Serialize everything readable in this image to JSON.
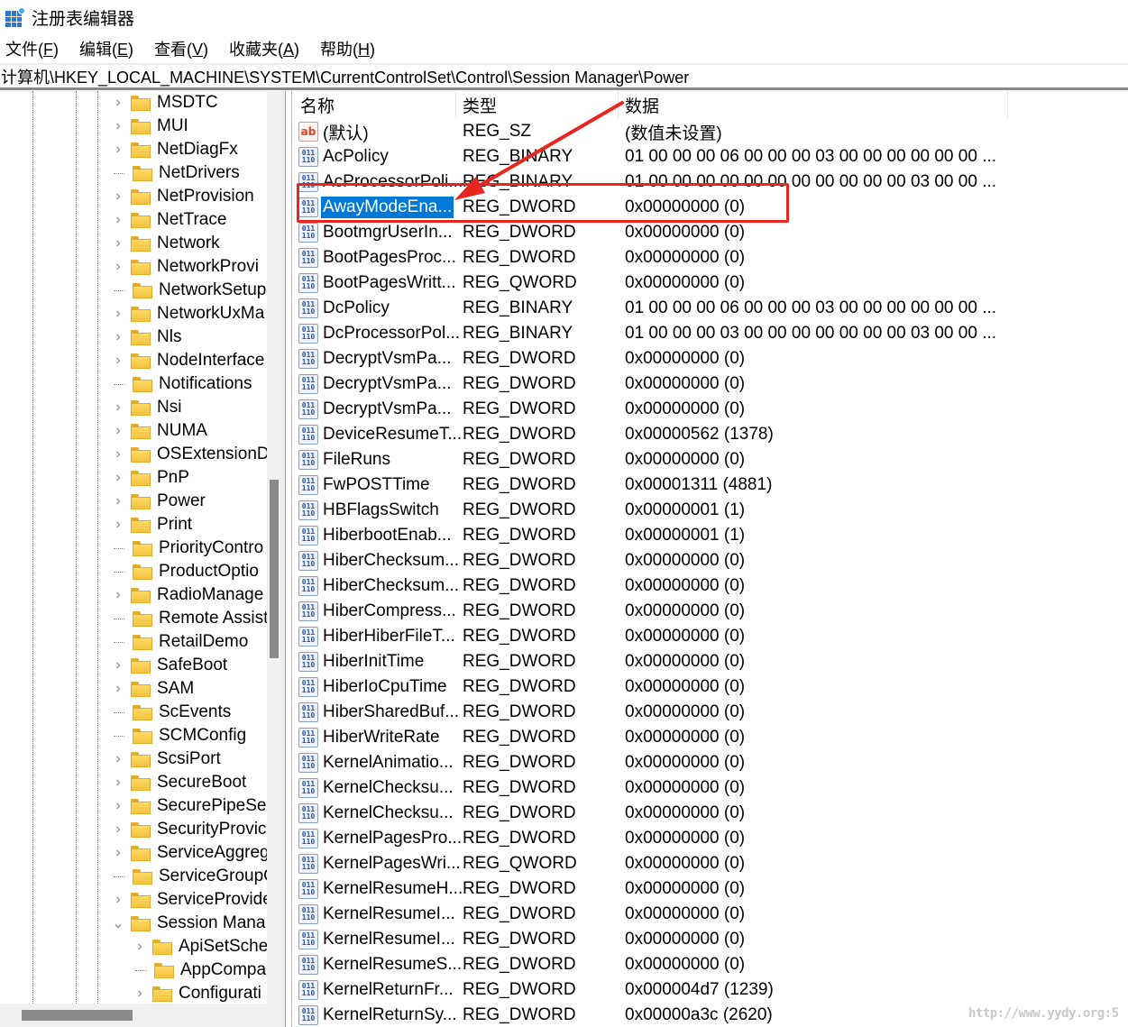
{
  "window": {
    "title": "注册表编辑器",
    "icon": "registry-editor-icon"
  },
  "menu": [
    {
      "label": "文件(",
      "key": "F",
      "suffix": ")"
    },
    {
      "label": "编辑(",
      "key": "E",
      "suffix": ")"
    },
    {
      "label": "查看(",
      "key": "V",
      "suffix": ")"
    },
    {
      "label": "收藏夹(",
      "key": "A",
      "suffix": ")"
    },
    {
      "label": "帮助(",
      "key": "H",
      "suffix": ")"
    }
  ],
  "address": "计算机\\HKEY_LOCAL_MACHINE\\SYSTEM\\CurrentControlSet\\Control\\Session Manager\\Power",
  "tree": {
    "items": [
      {
        "label": "MSDTC",
        "expandable": true,
        "level": 0
      },
      {
        "label": "MUI",
        "expandable": true,
        "level": 0
      },
      {
        "label": "NetDiagFx",
        "expandable": true,
        "level": 0
      },
      {
        "label": "NetDrivers",
        "expandable": false,
        "level": 0
      },
      {
        "label": "NetProvision",
        "expandable": true,
        "level": 0
      },
      {
        "label": "NetTrace",
        "expandable": true,
        "level": 0
      },
      {
        "label": "Network",
        "expandable": true,
        "level": 0
      },
      {
        "label": "NetworkProvi",
        "expandable": true,
        "level": 0
      },
      {
        "label": "NetworkSetup",
        "expandable": false,
        "level": 0
      },
      {
        "label": "NetworkUxMa",
        "expandable": true,
        "level": 0
      },
      {
        "label": "Nls",
        "expandable": true,
        "level": 0
      },
      {
        "label": "NodeInterface",
        "expandable": true,
        "level": 0
      },
      {
        "label": "Notifications",
        "expandable": false,
        "level": 0
      },
      {
        "label": "Nsi",
        "expandable": true,
        "level": 0
      },
      {
        "label": "NUMA",
        "expandable": true,
        "level": 0
      },
      {
        "label": "OSExtensionD",
        "expandable": true,
        "level": 0
      },
      {
        "label": "PnP",
        "expandable": true,
        "level": 0
      },
      {
        "label": "Power",
        "expandable": true,
        "level": 0
      },
      {
        "label": "Print",
        "expandable": true,
        "level": 0
      },
      {
        "label": "PriorityContro",
        "expandable": false,
        "level": 0
      },
      {
        "label": "ProductOptio",
        "expandable": false,
        "level": 0
      },
      {
        "label": "RadioManage",
        "expandable": true,
        "level": 0
      },
      {
        "label": "Remote Assist",
        "expandable": false,
        "level": 0
      },
      {
        "label": "RetailDemo",
        "expandable": false,
        "level": 0
      },
      {
        "label": "SafeBoot",
        "expandable": true,
        "level": 0
      },
      {
        "label": "SAM",
        "expandable": true,
        "level": 0
      },
      {
        "label": "ScEvents",
        "expandable": false,
        "level": 0
      },
      {
        "label": "SCMConfig",
        "expandable": false,
        "level": 0
      },
      {
        "label": "ScsiPort",
        "expandable": true,
        "level": 0
      },
      {
        "label": "SecureBoot",
        "expandable": true,
        "level": 0
      },
      {
        "label": "SecurePipeSer",
        "expandable": true,
        "level": 0
      },
      {
        "label": "SecurityProvic",
        "expandable": true,
        "level": 0
      },
      {
        "label": "ServiceAggreg",
        "expandable": true,
        "level": 0
      },
      {
        "label": "ServiceGroupO",
        "expandable": false,
        "level": 0
      },
      {
        "label": "ServiceProvide",
        "expandable": true,
        "level": 0
      },
      {
        "label": "Session Mana",
        "expandable": true,
        "expanded": true,
        "level": 0
      },
      {
        "label": "ApiSetSche",
        "expandable": true,
        "level": 1
      },
      {
        "label": "AppCompa",
        "expandable": false,
        "level": 1
      },
      {
        "label": "Configurati",
        "expandable": true,
        "level": 1
      }
    ]
  },
  "list": {
    "columns": {
      "name": "名称",
      "type": "类型",
      "data": "数据"
    },
    "rows": [
      {
        "name": "(默认)",
        "type": "REG_SZ",
        "data": "(数值未设置)",
        "icon": "sz"
      },
      {
        "name": "AcPolicy",
        "type": "REG_BINARY",
        "data": "01 00 00 00 06 00 00 00 03 00 00 00 00 00 00 ...",
        "icon": "bin"
      },
      {
        "name": "AcProcessorPoli...",
        "type": "REG_BINARY",
        "data": "01 00 00 00 00 00 00 00 00 00 00 00 03 00 00 ...",
        "icon": "bin"
      },
      {
        "name": "AwayModeEna...",
        "type": "REG_DWORD",
        "data": "0x00000000 (0)",
        "icon": "bin",
        "selected": true
      },
      {
        "name": "BootmgrUserIn...",
        "type": "REG_DWORD",
        "data": "0x00000000 (0)",
        "icon": "bin"
      },
      {
        "name": "BootPagesProc...",
        "type": "REG_DWORD",
        "data": "0x00000000 (0)",
        "icon": "bin"
      },
      {
        "name": "BootPagesWritt...",
        "type": "REG_QWORD",
        "data": "0x00000000 (0)",
        "icon": "bin"
      },
      {
        "name": "DcPolicy",
        "type": "REG_BINARY",
        "data": "01 00 00 00 06 00 00 00 03 00 00 00 00 00 00 ...",
        "icon": "bin"
      },
      {
        "name": "DcProcessorPol...",
        "type": "REG_BINARY",
        "data": "01 00 00 00 03 00 00 00 00 00 00 00 03 00 00 ...",
        "icon": "bin"
      },
      {
        "name": "DecryptVsmPa...",
        "type": "REG_DWORD",
        "data": "0x00000000 (0)",
        "icon": "bin"
      },
      {
        "name": "DecryptVsmPa...",
        "type": "REG_DWORD",
        "data": "0x00000000 (0)",
        "icon": "bin"
      },
      {
        "name": "DecryptVsmPa...",
        "type": "REG_DWORD",
        "data": "0x00000000 (0)",
        "icon": "bin"
      },
      {
        "name": "DeviceResumeT...",
        "type": "REG_DWORD",
        "data": "0x00000562 (1378)",
        "icon": "bin"
      },
      {
        "name": "FileRuns",
        "type": "REG_DWORD",
        "data": "0x00000000 (0)",
        "icon": "bin"
      },
      {
        "name": "FwPOSTTime",
        "type": "REG_DWORD",
        "data": "0x00001311 (4881)",
        "icon": "bin"
      },
      {
        "name": "HBFlagsSwitch",
        "type": "REG_DWORD",
        "data": "0x00000001 (1)",
        "icon": "bin"
      },
      {
        "name": "HiberbootEnab...",
        "type": "REG_DWORD",
        "data": "0x00000001 (1)",
        "icon": "bin"
      },
      {
        "name": "HiberChecksum...",
        "type": "REG_DWORD",
        "data": "0x00000000 (0)",
        "icon": "bin"
      },
      {
        "name": "HiberChecksum...",
        "type": "REG_DWORD",
        "data": "0x00000000 (0)",
        "icon": "bin"
      },
      {
        "name": "HiberCompress...",
        "type": "REG_DWORD",
        "data": "0x00000000 (0)",
        "icon": "bin"
      },
      {
        "name": "HiberHiberFileT...",
        "type": "REG_DWORD",
        "data": "0x00000000 (0)",
        "icon": "bin"
      },
      {
        "name": "HiberInitTime",
        "type": "REG_DWORD",
        "data": "0x00000000 (0)",
        "icon": "bin"
      },
      {
        "name": "HiberIoCpuTime",
        "type": "REG_DWORD",
        "data": "0x00000000 (0)",
        "icon": "bin"
      },
      {
        "name": "HiberSharedBuf...",
        "type": "REG_DWORD",
        "data": "0x00000000 (0)",
        "icon": "bin"
      },
      {
        "name": "HiberWriteRate",
        "type": "REG_DWORD",
        "data": "0x00000000 (0)",
        "icon": "bin"
      },
      {
        "name": "KernelAnimatio...",
        "type": "REG_DWORD",
        "data": "0x00000000 (0)",
        "icon": "bin"
      },
      {
        "name": "KernelChecksu...",
        "type": "REG_DWORD",
        "data": "0x00000000 (0)",
        "icon": "bin"
      },
      {
        "name": "KernelChecksu...",
        "type": "REG_DWORD",
        "data": "0x00000000 (0)",
        "icon": "bin"
      },
      {
        "name": "KernelPagesPro...",
        "type": "REG_DWORD",
        "data": "0x00000000 (0)",
        "icon": "bin"
      },
      {
        "name": "KernelPagesWri...",
        "type": "REG_QWORD",
        "data": "0x00000000 (0)",
        "icon": "bin"
      },
      {
        "name": "KernelResumeH...",
        "type": "REG_DWORD",
        "data": "0x00000000 (0)",
        "icon": "bin"
      },
      {
        "name": "KernelResumeI...",
        "type": "REG_DWORD",
        "data": "0x00000000 (0)",
        "icon": "bin"
      },
      {
        "name": "KernelResumeI...",
        "type": "REG_DWORD",
        "data": "0x00000000 (0)",
        "icon": "bin"
      },
      {
        "name": "KernelResumeS...",
        "type": "REG_DWORD",
        "data": "0x00000000 (0)",
        "icon": "bin"
      },
      {
        "name": "KernelReturnFr...",
        "type": "REG_DWORD",
        "data": "0x000004d7 (1239)",
        "icon": "bin"
      },
      {
        "name": "KernelReturnSy...",
        "type": "REG_DWORD",
        "data": "0x00000a3c (2620)",
        "icon": "bin"
      }
    ]
  },
  "annotation": {
    "color": "#e8261f",
    "target": "AwayModeEna..."
  },
  "watermark": "http://www.yydy.org:5",
  "colors": {
    "selection": "#0078d7",
    "annotation": "#e8261f"
  }
}
